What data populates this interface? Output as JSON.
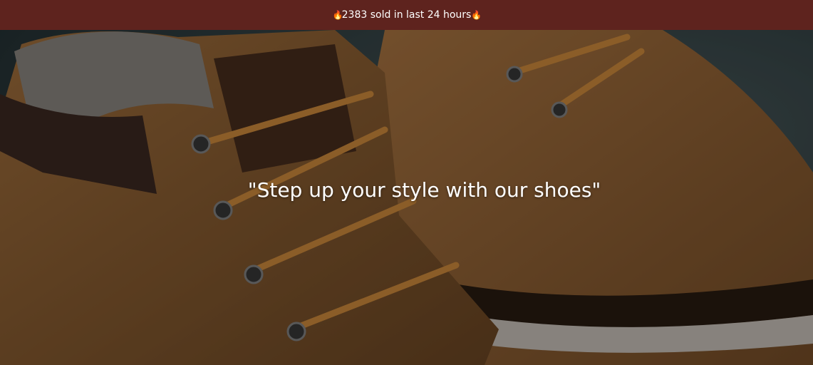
{
  "announcement": {
    "fire_icon": "fire-icon",
    "text": "2383 sold in last 24 hours"
  },
  "hero": {
    "headline": "\"Step up your style with our shoes\"",
    "image_subject": "boot-photo"
  },
  "colors": {
    "announcement_bg": "#5e231e",
    "announcement_text": "#ffffff",
    "headline_text": "#ffffff"
  }
}
